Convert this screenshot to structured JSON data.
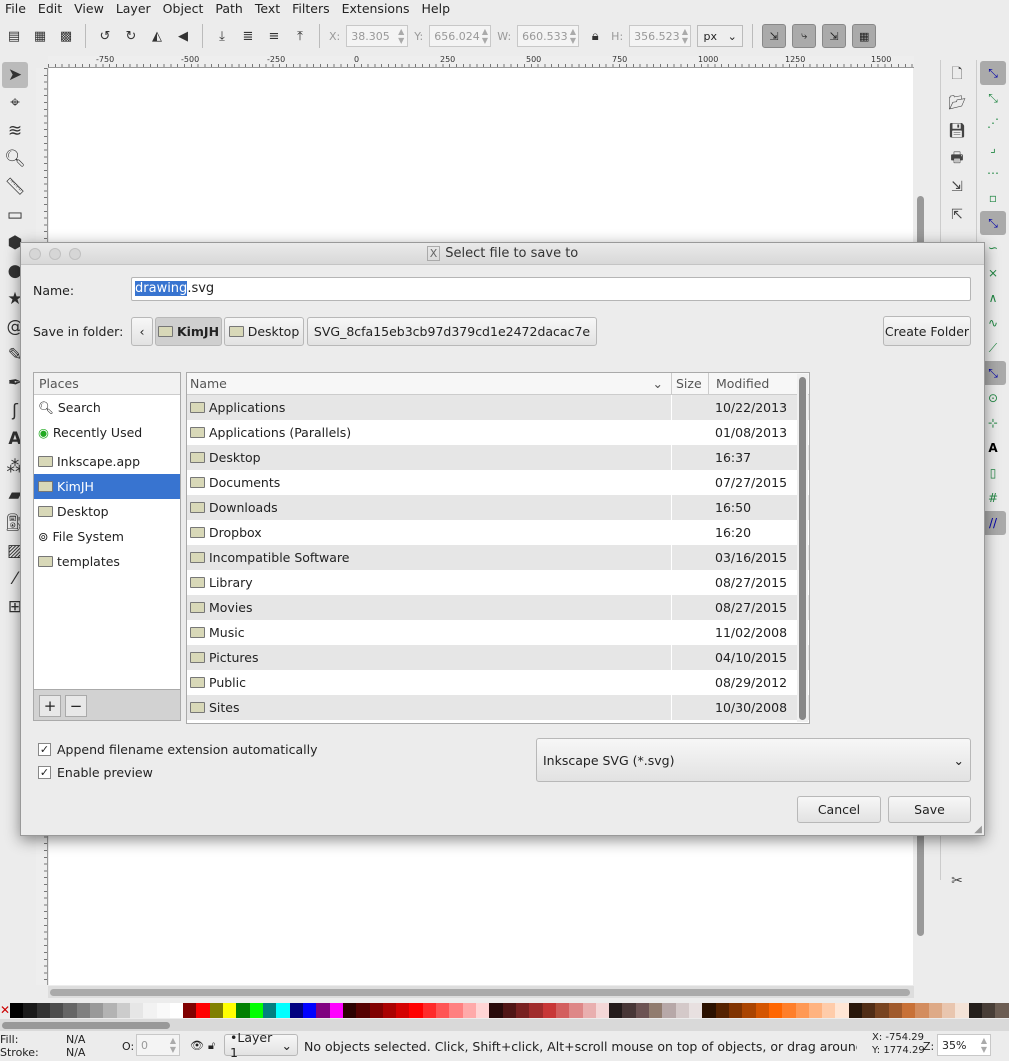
{
  "menu": [
    "File",
    "Edit",
    "View",
    "Layer",
    "Object",
    "Path",
    "Text",
    "Filters",
    "Extensions",
    "Help"
  ],
  "toolbar": {
    "x_label": "X:",
    "x": "38.305",
    "y_label": "Y:",
    "y": "656.024",
    "w_label": "W:",
    "w": "660.533",
    "h_label": "H:",
    "h": "356.523",
    "unit": "px"
  },
  "ruler_ticks": [
    "-750",
    "-500",
    "-250",
    "0",
    "250",
    "500",
    "750",
    "1000",
    "1250",
    "1500"
  ],
  "dialog": {
    "title": "Select file to save to",
    "name_label": "Name:",
    "name_selected": "drawing",
    "name_rest": ".svg",
    "folder_label": "Save in folder:",
    "path": [
      "KimJH",
      "Desktop",
      "SVG_8cfa15eb3cb97d379cd1e2472dacac7e"
    ],
    "create_folder": "Create Folder",
    "places_header": "Places",
    "places": [
      {
        "label": "Search",
        "icon": "search-icon"
      },
      {
        "label": "Recently Used",
        "icon": "recent-icon"
      },
      {
        "label": "Inkscape.app",
        "icon": "folder-icon"
      },
      {
        "label": "KimJH",
        "icon": "folder-icon",
        "selected": true
      },
      {
        "label": "Desktop",
        "icon": "folder-icon"
      },
      {
        "label": "File System",
        "icon": "drive-icon"
      },
      {
        "label": "templates",
        "icon": "folder-icon"
      }
    ],
    "columns": {
      "name": "Name",
      "size": "Size",
      "modified": "Modified"
    },
    "files": [
      {
        "name": "Applications",
        "modified": "10/22/2013"
      },
      {
        "name": "Applications (Parallels)",
        "modified": "01/08/2013"
      },
      {
        "name": "Desktop",
        "modified": "16:37"
      },
      {
        "name": "Documents",
        "modified": "07/27/2015"
      },
      {
        "name": "Downloads",
        "modified": "16:50"
      },
      {
        "name": "Dropbox",
        "modified": "16:20"
      },
      {
        "name": "Incompatible Software",
        "modified": "03/16/2015"
      },
      {
        "name": "Library",
        "modified": "08/27/2015"
      },
      {
        "name": "Movies",
        "modified": "08/27/2015"
      },
      {
        "name": "Music",
        "modified": "11/02/2008"
      },
      {
        "name": "Pictures",
        "modified": "04/10/2015"
      },
      {
        "name": "Public",
        "modified": "08/29/2012"
      },
      {
        "name": "Sites",
        "modified": "10/30/2008"
      }
    ],
    "append_ext": {
      "label": "Append filename extension automatically",
      "checked": true
    },
    "enable_preview": {
      "label": "Enable preview",
      "checked": true
    },
    "filetype": "Inkscape SVG (*.svg)",
    "cancel": "Cancel",
    "save": "Save"
  },
  "palette": [
    "#000000",
    "#1a1a1a",
    "#333333",
    "#4d4d4d",
    "#666666",
    "#808080",
    "#999999",
    "#b3b3b3",
    "#cccccc",
    "#e6e6e6",
    "#f2f2f2",
    "#f9f9f9",
    "#ffffff",
    "#800000",
    "#ff0000",
    "#808000",
    "#ffff00",
    "#008000",
    "#00ff00",
    "#008080",
    "#00ffff",
    "#000080",
    "#0000ff",
    "#800080",
    "#ff00ff",
    "#2b0000",
    "#550000",
    "#800000",
    "#aa0000",
    "#d40000",
    "#ff0000",
    "#ff2a2a",
    "#ff5555",
    "#ff8080",
    "#ffaaaa",
    "#ffd5d5",
    "#280b0b",
    "#501616",
    "#782121",
    "#a02c2c",
    "#c83737",
    "#d35f5f",
    "#de8787",
    "#e9afaf",
    "#f4d7d7",
    "#241c1c",
    "#483737",
    "#6c5353",
    "#917c6f",
    "#b7a8a8",
    "#d4c9c9",
    "#e8e0e0",
    "#2b1100",
    "#552200",
    "#803300",
    "#aa4400",
    "#d45500",
    "#ff6600",
    "#ff7f2a",
    "#ff9955",
    "#ffb380",
    "#ffccaa",
    "#ffe6d5",
    "#28170b",
    "#502d16",
    "#784421",
    "#a05a2c",
    "#c87137",
    "#d38d5f",
    "#deaa87",
    "#e9c6af",
    "#f4e3d7",
    "#241f1c",
    "#483e37",
    "#6c5d53"
  ],
  "status": {
    "fill_label": "Fill:",
    "fill": "N/A",
    "stroke_label": "Stroke:",
    "stroke": "N/A",
    "opacity_label": "O:",
    "opacity": "0",
    "layer": "•Layer 1",
    "message": "No objects selected. Click, Shift+click, Alt+scroll mouse on top of objects, or drag around ob",
    "cursor_x": "X: -754.29",
    "cursor_y": "Y: 1774.29",
    "zoom_label": "Z:",
    "zoom": "35%"
  }
}
